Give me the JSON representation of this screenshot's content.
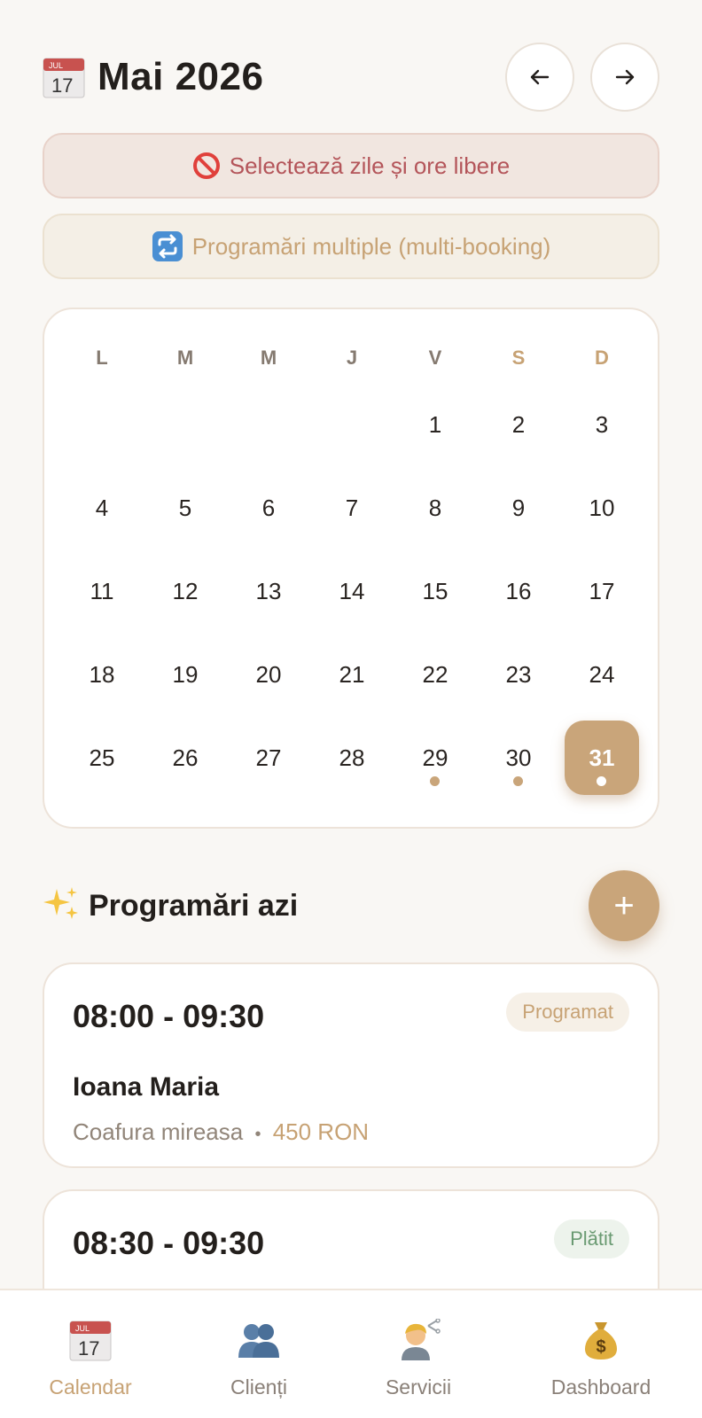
{
  "header": {
    "calendar_icon_month": "JUL",
    "calendar_icon_day": "17",
    "title": "Mai 2026",
    "prev_icon": "arrow-left-icon",
    "next_icon": "arrow-right-icon"
  },
  "banners": {
    "block_label": "Selectează zile și ore libere",
    "block_icon": "prohibited-icon",
    "multi_label": "Programări multiple (multi-booking)",
    "multi_icon": "repeat-icon"
  },
  "calendar": {
    "weekdays": [
      "L",
      "M",
      "M",
      "J",
      "V",
      "S",
      "D"
    ],
    "first_weekday_index": 4,
    "days_in_month": 31,
    "selected_day": 31,
    "days_with_appointments": [
      29,
      30,
      31
    ]
  },
  "section": {
    "icon": "sparkles-icon",
    "title": "Programări azi",
    "add_label": "+"
  },
  "appointments": [
    {
      "time": "08:00 - 09:30",
      "status": "Programat",
      "client": "Ioana Maria",
      "service": "Coafura mireasa",
      "separator": "•",
      "price": "450 RON"
    },
    {
      "time": "08:30 - 09:30",
      "status": "Plătit"
    }
  ],
  "tabs": [
    {
      "label": "Calendar",
      "icon": "calendar-icon",
      "active": true
    },
    {
      "label": "Clienți",
      "icon": "people-icon",
      "active": false
    },
    {
      "label": "Servicii",
      "icon": "hairdresser-icon",
      "active": false
    },
    {
      "label": "Dashboard",
      "icon": "money-bag-icon",
      "active": false
    }
  ],
  "colors": {
    "accent": "#c9a57a",
    "background": "#f9f7f4",
    "danger_text": "#b4555a",
    "success_text": "#6a9a72"
  }
}
